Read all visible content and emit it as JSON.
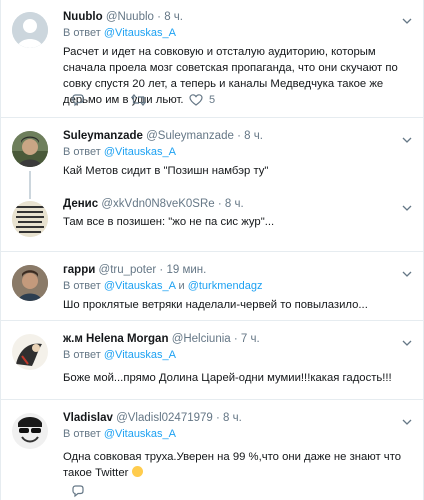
{
  "reply_prefix": "В ответ",
  "tweets": [
    {
      "name": "Nuublo",
      "handle": "@Nuublo",
      "dot": "·",
      "time": "8 ч.",
      "reply_to": "@Vitauskas_A",
      "text": "Расчет и идет на совковую и  отсталую аудиторию, которым сначала проела мозг советская пропаганда, что они скучают по совку спустя 20 лет, а теперь и каналы Медведчука такое же дерьмо им в уши льют.",
      "likes": "5"
    },
    {
      "name": "Suleymanzade",
      "handle": "@Suleymanzade",
      "dot": "·",
      "time": "8 ч.",
      "reply_to": "@Vitauskas_A",
      "text": "Кай Метов сидит в \"Позишн намбэр ту\""
    },
    {
      "name": "Денис",
      "handle": "@xkVdn0N8veK0SRe",
      "dot": "·",
      "time": "8 ч.",
      "text": "Там все в позишен: \"жо не па сис жур\"..."
    },
    {
      "name": "гарри",
      "handle": "@tru_poter",
      "dot": "·",
      "time": "19 мин.",
      "reply_to": "@Vitauskas_A",
      "reply_and": "и",
      "reply_to2": "@turkmendagz",
      "text": "Шо проклятые ветряки наделали-червей то повылазило..."
    },
    {
      "name": "ж.м Helena Morgan",
      "handle": "@Helciunia",
      "dot": "·",
      "time": "7 ч.",
      "reply_to": "@Vitauskas_A",
      "text": "Боже мой...прямо Долина Царей-одни мумии!!!какая гадость!!!"
    },
    {
      "name": "Vladislav",
      "handle": "@Vladisl02471979",
      "dot": "·",
      "time": "8 ч.",
      "reply_to": "@Vitauskas_A",
      "text": "Одна совковая труха.Уверен на 99 %,что они даже не знают что такое Twitter"
    }
  ],
  "colors": {
    "link": "#1da1f2",
    "muted": "#657786",
    "border": "#e6ecf0",
    "text": "#14171a"
  },
  "icons": [
    "reply-icon",
    "retweet-icon",
    "like-icon",
    "chevron-down-icon",
    "default-avatar-icon",
    "emoji-icon"
  ]
}
